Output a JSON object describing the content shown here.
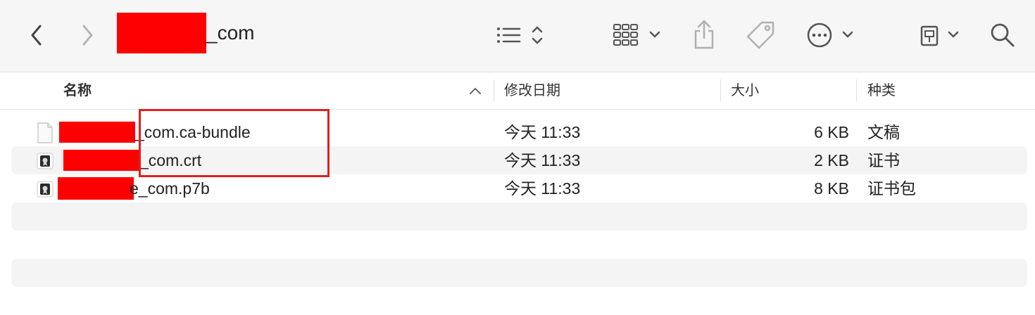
{
  "window": {
    "title_suffix": "_com"
  },
  "toolbar": {
    "back_icon": "chevron-left-icon",
    "forward_icon": "chevron-right-icon",
    "list_view_icon": "list-view-icon",
    "group_icon": "grid-group-icon",
    "share_icon": "share-icon",
    "tag_icon": "tag-icon",
    "more_icon": "ellipsis-circle-icon",
    "device_icon": "usb-drive-icon",
    "search_icon": "search-icon"
  },
  "columns": {
    "name": "名称",
    "modified": "修改日期",
    "size": "大小",
    "kind": "种类"
  },
  "files": [
    {
      "name_suffix": "_com.ca-bundle",
      "modified": "今天 11:33",
      "size": "6 KB",
      "kind": "文稿",
      "icon": "document-icon"
    },
    {
      "name_suffix": "_com.crt",
      "modified": "今天 11:33",
      "size": "2 KB",
      "kind": "证书",
      "icon": "certificate-icon"
    },
    {
      "name_suffix": "e_com.p7b",
      "modified": "今天 11:33",
      "size": "8 KB",
      "kind": "证书包",
      "icon": "certificate-icon"
    }
  ],
  "colors": {
    "redaction": "#ff0000",
    "highlight_border": "#e02020",
    "row_alt": "#f4f4f4",
    "toolbar_bg": "#f6f6f6"
  }
}
